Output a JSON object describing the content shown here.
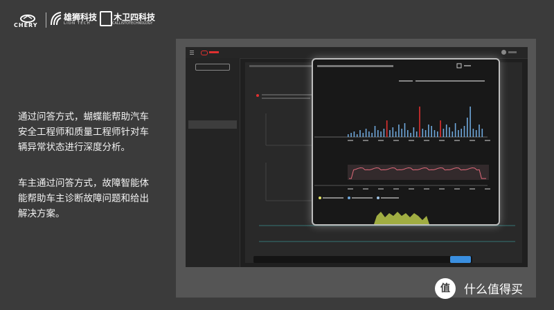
{
  "logos": {
    "chery": "CHERY",
    "lion_cn": "雄狮科技",
    "lion_en": "LION TECH",
    "callisto_cn": "木卫四科技",
    "callisto_en": "CALLISTOTECHNOLOGY"
  },
  "description": {
    "para1": "通过问答方式，蝴蝶能帮助汽车安全工程师和质量工程师针对车辆异常状态进行深度分析。",
    "para2": "车主通过问答方式，故障智能体能帮助车主诊断故障问题和给出解决方案。"
  },
  "watermark": {
    "text": "什么值得买",
    "icon": "值"
  },
  "app": {
    "colors": {
      "accent": "#3a8fe0",
      "alert": "#e03030",
      "line": "#e06a7a",
      "bar_blue": "#6fa8dc"
    }
  }
}
